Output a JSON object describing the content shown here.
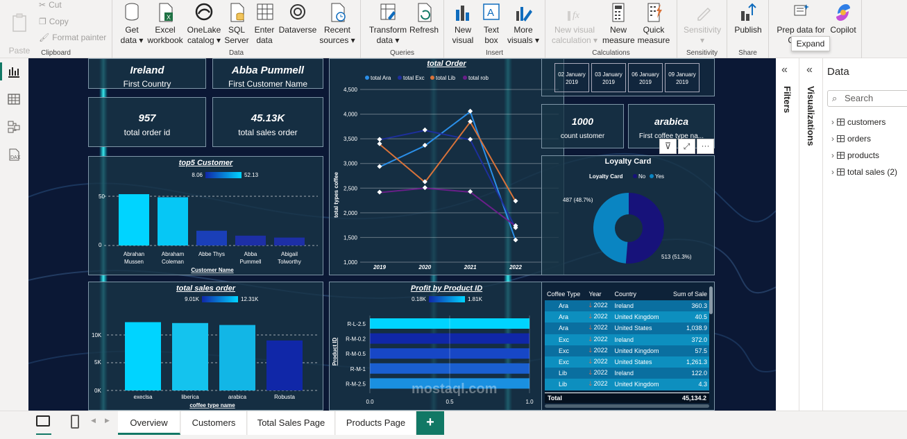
{
  "ribbon": {
    "clipboard": {
      "paste": "Paste",
      "cut": "Cut",
      "copy": "Copy",
      "format_painter": "Format painter",
      "group": "Clipboard"
    },
    "data": {
      "get_data": "Get\ndata ▾",
      "excel": "Excel\nworkbook",
      "onelake": "OneLake\ncatalog ▾",
      "sql": "SQL\nServer",
      "enter": "Enter\ndata",
      "dataverse": "Dataverse",
      "recent": "Recent\nsources ▾",
      "group": "Data"
    },
    "queries": {
      "transform": "Transform\ndata ▾",
      "refresh": "Refresh",
      "group": "Queries"
    },
    "insert": {
      "new_visual": "New\nvisual",
      "text_box": "Text\nbox",
      "more_visuals": "More\nvisuals ▾",
      "group": "Insert"
    },
    "calculations": {
      "new_visual_calc": "New visual\ncalculation ▾",
      "new_measure": "New\nmeasure",
      "quick_measure": "Quick\nmeasure",
      "group": "Calculations"
    },
    "sensitivity": {
      "sensitivity": "Sensitivity\n▾",
      "group": "Sensitivity"
    },
    "share": {
      "publish": "Publish",
      "group": "Share"
    },
    "copilot": {
      "prep": "Prep data for Copilot",
      "copilot": "Copilot",
      "tooltip": "Expand"
    }
  },
  "kpis": {
    "first_country": {
      "value": "Ireland",
      "label": "First Country"
    },
    "first_customer": {
      "value": "Abba Pummell",
      "label": "First Customer Name"
    },
    "order_id": {
      "value": "957",
      "label": "total order id"
    },
    "sales_order": {
      "value": "45.13K",
      "label": "total sales order"
    },
    "count_customer": {
      "value": "1000",
      "label": "count ustomer"
    },
    "coffee_type": {
      "value": "arabica",
      "label": "First coffee type na..."
    }
  },
  "dates": [
    "02 January\n2019",
    "03 January\n2019",
    "06 January\n2019",
    "09 January\n2019"
  ],
  "top5": {
    "title": "top5 Customer",
    "legend_min": "8.06",
    "legend_max": "52.13",
    "xlabel": "Customer Name",
    "ticks": [
      "50",
      "0"
    ],
    "categories": [
      "Abrahan\nMussen",
      "Abraham\nColeman",
      "Abbe Thys",
      "Abba\nPummell",
      "Abigail\nTolworthy"
    ],
    "values": [
      52.13,
      49,
      15,
      10,
      8.06
    ]
  },
  "sales_order_chart": {
    "title": "total sales order",
    "legend_min": "9.01K",
    "legend_max": "12.31K",
    "xlabel": "coffee type name",
    "ticks": [
      "10K",
      "5K",
      "0K"
    ],
    "categories": [
      "execlsa",
      "liberica",
      "arabica",
      "Robusta"
    ],
    "values": [
      12310,
      12150,
      11800,
      9010
    ]
  },
  "profit_chart": {
    "title": "Profit by Product ID",
    "legend_min": "0.18K",
    "legend_max": "1.81K",
    "ylabel": "Product ID",
    "categories": [
      "R-L-2.5",
      "R-M-0.2",
      "R-M-0.5",
      "R-M-1",
      "R-M-2.5"
    ],
    "xticks": [
      "0.0",
      "0.5",
      "1.0"
    ]
  },
  "chart_data": {
    "type": "line",
    "title": "total Order",
    "ylabel": "total types coffee",
    "x": [
      "2019",
      "2020",
      "2021",
      "2022"
    ],
    "ylim": [
      1000,
      4500
    ],
    "yticks": [
      "4,500",
      "4,000",
      "3,500",
      "3,000",
      "2,500",
      "2,000",
      "1,500",
      "1,000"
    ],
    "series": [
      {
        "name": "total Ara",
        "color": "#2b8fe8",
        "values": [
          2930,
          3360,
          4050,
          1440
        ]
      },
      {
        "name": "total Exc",
        "color": "#1d2f9c",
        "values": [
          3480,
          3670,
          3480,
          1690
        ]
      },
      {
        "name": "total Lib",
        "color": "#d9733a",
        "values": [
          3390,
          2620,
          3840,
          2230
        ]
      },
      {
        "name": "total rob",
        "color": "#6a1f8a",
        "values": [
          2410,
          2500,
          2420,
          1730
        ]
      }
    ]
  },
  "loyalty": {
    "title": "Loyalty Card",
    "legend_title": "Loyalty Card",
    "legend": [
      "No",
      "Yes"
    ],
    "label_yes": "487 (48.7%)",
    "label_no": "513 (51.3%)",
    "values": {
      "no": 513,
      "yes": 487
    }
  },
  "table": {
    "headers": [
      "Coffee Type",
      "Year",
      "Country",
      "Sum of Sale"
    ],
    "rows": [
      [
        "Ara",
        "2022",
        "Ireland",
        "360.3"
      ],
      [
        "Ara",
        "2022",
        "United Kingdom",
        "40.5"
      ],
      [
        "Ara",
        "2022",
        "United States",
        "1,038.9"
      ],
      [
        "Exc",
        "2022",
        "Ireland",
        "372.0"
      ],
      [
        "Exc",
        "2022",
        "United Kingdom",
        "57.5"
      ],
      [
        "Exc",
        "2022",
        "United States",
        "1,261.3"
      ],
      [
        "Lib",
        "2022",
        "Ireland",
        "122.0"
      ],
      [
        "Lib",
        "2022",
        "United Kingdom",
        "4.3"
      ]
    ],
    "total_label": "Total",
    "total_value": "45,134.2"
  },
  "panes": {
    "filters": "Filters",
    "visualizations": "Visualizations",
    "data": "Data",
    "search": "Search",
    "tables": [
      "customers",
      "orders",
      "products",
      "total sales (2)"
    ]
  },
  "tabs": [
    "Overview",
    "Customers",
    "Total Sales Page",
    "Products Page"
  ],
  "watermark": "mostaql.com"
}
